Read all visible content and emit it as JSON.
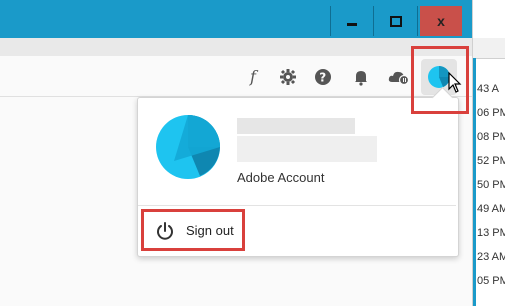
{
  "window": {
    "controls": {
      "minimize_icon": "minimize-icon",
      "maximize_icon": "maximize-icon",
      "close_glyph": "x"
    },
    "titlebar_color": "#1a9ac9",
    "close_color": "#c9504a"
  },
  "toolbar": {
    "icons": [
      "script-f-icon",
      "gear-icon",
      "help-icon",
      "bell-icon",
      "cloud-sync-icon",
      "avatar-icon"
    ]
  },
  "account_menu": {
    "account_label": "Adobe Account",
    "sign_out_label": "Sign out"
  },
  "background_list": {
    "times": [
      "43 A",
      "06 PM",
      "08 PM",
      "52 PM",
      "50 PM",
      "49 AM",
      "13 PM",
      "23 AM",
      "05 PM"
    ]
  },
  "annotation_color": "#d9403c"
}
